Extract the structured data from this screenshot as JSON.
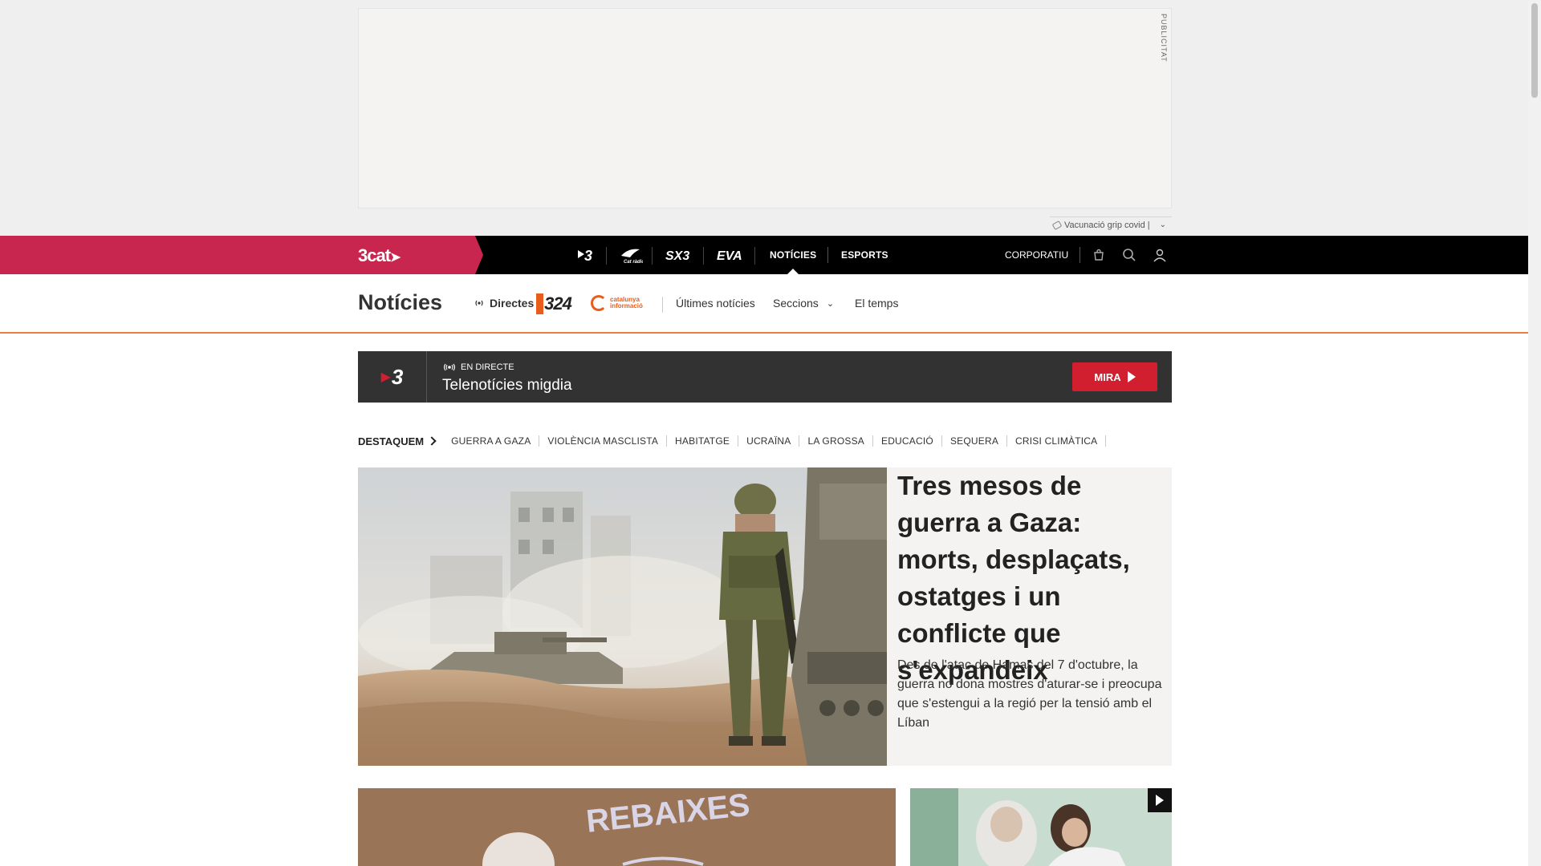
{
  "ad": {
    "label": "PUBLICITAT",
    "topic": "Vacunació grip covid |"
  },
  "topnav": {
    "brand": "3cat",
    "channels": [
      "3",
      "Cat Ràdio",
      "SX3",
      "EVA"
    ],
    "links": [
      "NOTÍCIES",
      "ESPORTS"
    ],
    "active_link": "NOTÍCIES",
    "corporate": "CORPORATIU",
    "icons": [
      "shop-icon",
      "search-icon",
      "user-icon"
    ]
  },
  "section": {
    "title": "Notícies",
    "live_label": "Directes",
    "channel_324": "324",
    "channel_cat_line1": "catalunya",
    "channel_cat_line2": "informació",
    "latest": "Últimes notícies",
    "sections": "Seccions",
    "weather": "El temps"
  },
  "live_banner": {
    "channel": "3",
    "tag": "EN DIRECTE",
    "title": "Telenotícies migdia",
    "button": "MIRA"
  },
  "highlights": {
    "head": "DESTAQUEM",
    "items": [
      "GUERRA A GAZA",
      "VIOLÈNCIA MASCLISTA",
      "HABITATGE",
      "UCRAÏNA",
      "LA GROSSA",
      "EDUCACIÓ",
      "SEQUERA",
      "CRISI CLIMÀTICA"
    ]
  },
  "hero": {
    "headline": "Tres mesos de guerra a Gaza: morts, desplaçats, ostatges i un conflicte que s'expandeix",
    "lead": "Des de l'atac de Hamas del 7 d'octubre, la guerra no dona mostres d'aturar-se i preocupa que s'estengui a la regió per la tensió amb el Líban"
  },
  "cards": {
    "card1_sign": "REBAIXES",
    "colors": {
      "brand": "#c8264f",
      "accent": "#e87f3d",
      "live_red": "#d21f2f"
    }
  }
}
